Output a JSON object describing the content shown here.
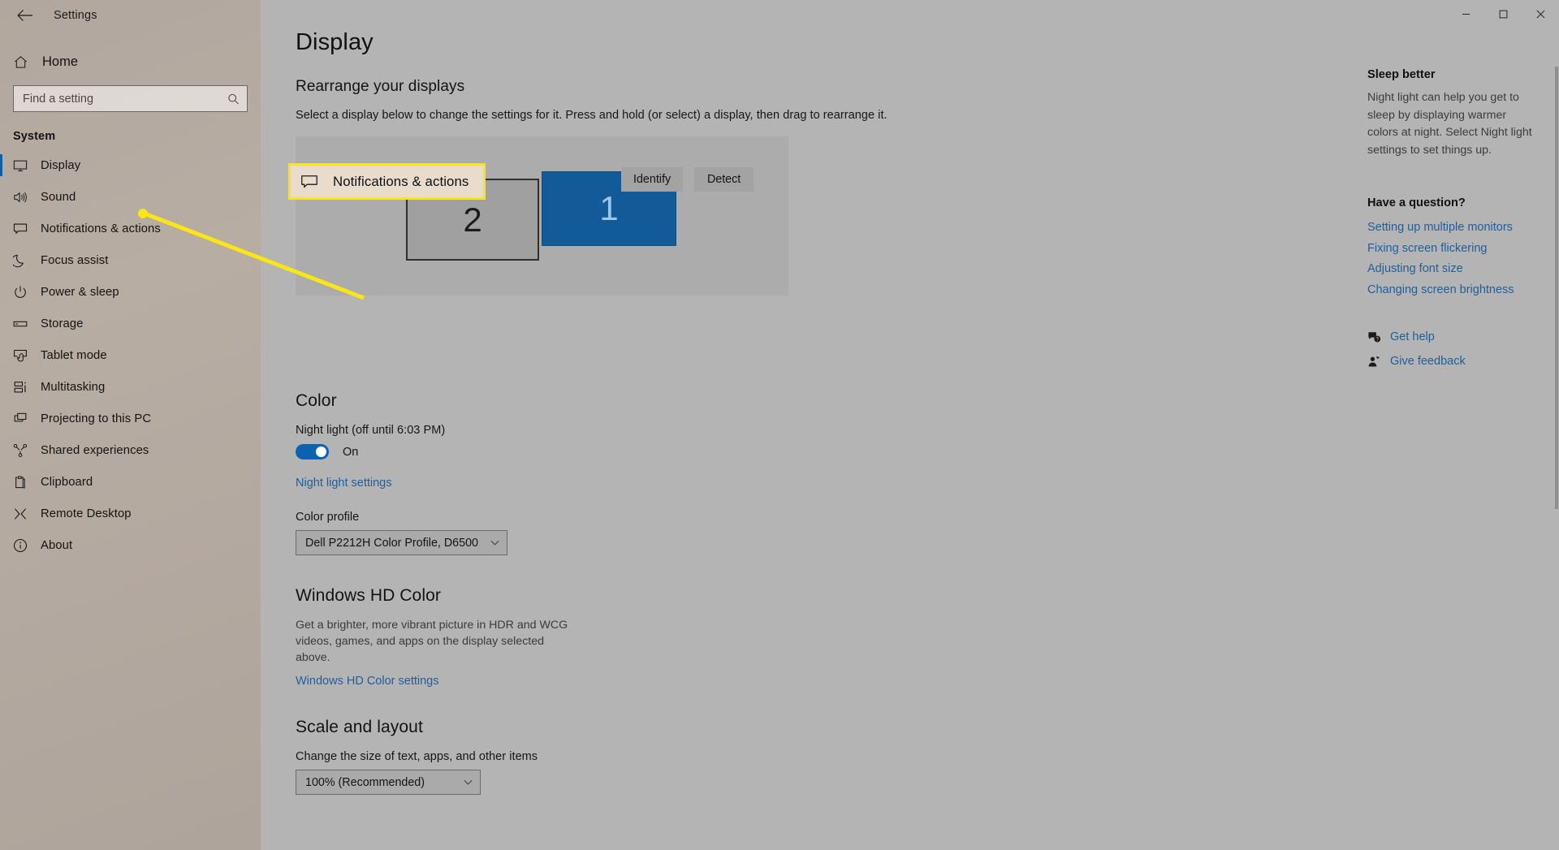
{
  "window": {
    "app_title": "Settings",
    "back_icon": "back-arrow-icon",
    "minimize": "—",
    "maximize": "▢",
    "close": "✕"
  },
  "sidebar": {
    "home_label": "Home",
    "home_icon": "home-icon",
    "search": {
      "placeholder": "Find a setting",
      "value": "",
      "icon": "search-icon"
    },
    "group_label": "System",
    "items": [
      {
        "label": "Display",
        "icon": "monitor-icon",
        "selected": true
      },
      {
        "label": "Sound",
        "icon": "speaker-icon",
        "selected": false
      },
      {
        "label": "Notifications & actions",
        "icon": "notification-icon",
        "selected": false
      },
      {
        "label": "Focus assist",
        "icon": "moon-icon",
        "selected": false
      },
      {
        "label": "Power & sleep",
        "icon": "power-icon",
        "selected": false
      },
      {
        "label": "Storage",
        "icon": "storage-icon",
        "selected": false
      },
      {
        "label": "Tablet mode",
        "icon": "tablet-icon",
        "selected": false
      },
      {
        "label": "Multitasking",
        "icon": "multitasking-icon",
        "selected": false
      },
      {
        "label": "Projecting to this PC",
        "icon": "projecting-icon",
        "selected": false
      },
      {
        "label": "Shared experiences",
        "icon": "share-icon",
        "selected": false
      },
      {
        "label": "Clipboard",
        "icon": "clipboard-icon",
        "selected": false
      },
      {
        "label": "Remote Desktop",
        "icon": "remote-desktop-icon",
        "selected": false
      },
      {
        "label": "About",
        "icon": "info-icon",
        "selected": false
      }
    ]
  },
  "main": {
    "page_title": "Display",
    "rearrange": {
      "heading": "Rearrange your displays",
      "description": "Select a display below to change the settings for it. Press and hold (or select) a display, then drag to rearrange it.",
      "monitors": [
        {
          "number": "2",
          "selected": false
        },
        {
          "number": "1",
          "selected": true
        }
      ],
      "identify_button": "Identify",
      "detect_button": "Detect"
    },
    "callout": {
      "label": "Notifications & actions",
      "icon": "notification-icon",
      "border_color": "#fae516",
      "fill_color": "#e9dccd"
    },
    "color": {
      "heading": "Color",
      "night_light_label": "Night light (off until 6:03 PM)",
      "toggle_state": "On",
      "toggle_on": true,
      "night_light_settings_link": "Night light settings",
      "color_profile_label": "Color profile",
      "color_profile_value": "Dell P2212H Color Profile, D6500"
    },
    "hd_color": {
      "heading": "Windows HD Color",
      "description": "Get a brighter, more vibrant picture in HDR and WCG videos, games, and apps on the display selected above.",
      "link": "Windows HD Color settings"
    },
    "scale": {
      "heading": "Scale and layout",
      "label": "Change the size of text, apps, and other items",
      "value": "100% (Recommended)"
    }
  },
  "right_panel": {
    "section1_title": "Sleep better",
    "section1_body": "Night light can help you get to sleep by displaying warmer colors at night. Select Night light settings to set things up.",
    "section2_title": "Have a question?",
    "links": [
      "Setting up multiple monitors",
      "Fixing screen flickering",
      "Adjusting font size",
      "Changing screen brightness"
    ],
    "icon_links": [
      {
        "label": "Get help",
        "icon": "help-icon"
      },
      {
        "label": "Give feedback",
        "icon": "feedback-icon"
      }
    ]
  },
  "colors": {
    "accent": "#0a63b0",
    "link": "#1d5f9e",
    "highlight": "#fae516",
    "selected_monitor": "#125a98"
  }
}
